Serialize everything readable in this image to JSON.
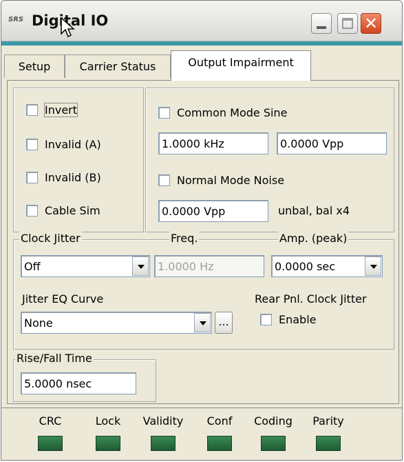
{
  "window": {
    "logo_text": "SRS",
    "title": "Digital IO",
    "minimize_icon": "minimize-icon",
    "maximize_icon": "maximize-icon",
    "close_glyph": "✕"
  },
  "tabs": [
    {
      "label": "Setup",
      "active": false
    },
    {
      "label": "Carrier Status",
      "active": false
    },
    {
      "label": "Output Impairment",
      "active": true
    }
  ],
  "impairments": {
    "invert": "Invert",
    "invalid_a": "Invalid (A)",
    "invalid_b": "Invalid (B)",
    "cable_sim": "Cable Sim"
  },
  "interference": {
    "common_mode_label": "Common Mode Sine",
    "cm_freq": "1.0000 kHz",
    "cm_amp": "0.0000 Vpp",
    "normal_mode_label": "Normal Mode Noise",
    "nm_amp": "0.0000 Vpp",
    "nm_note": "unbal, bal x4"
  },
  "jitter": {
    "clock_jitter_label": "Clock Jitter",
    "freq_label": "Freq.",
    "amp_label": "Amp. (peak)",
    "clock_jitter_value": "Off",
    "freq_value": "1.0000 Hz",
    "amp_value": "0.0000 sec",
    "eq_label": "Jitter EQ Curve",
    "eq_value": "None",
    "ellipsis": "...",
    "rear_label": "Rear Pnl. Clock Jitter",
    "enable_label": "Enable"
  },
  "rise_fall": {
    "label": "Rise/Fall Time",
    "value": "5.0000 nsec"
  },
  "status": {
    "indicators": [
      "CRC",
      "Lock",
      "Validity",
      "Conf",
      "Coding",
      "Parity"
    ],
    "led_color": "#2a7040"
  }
}
